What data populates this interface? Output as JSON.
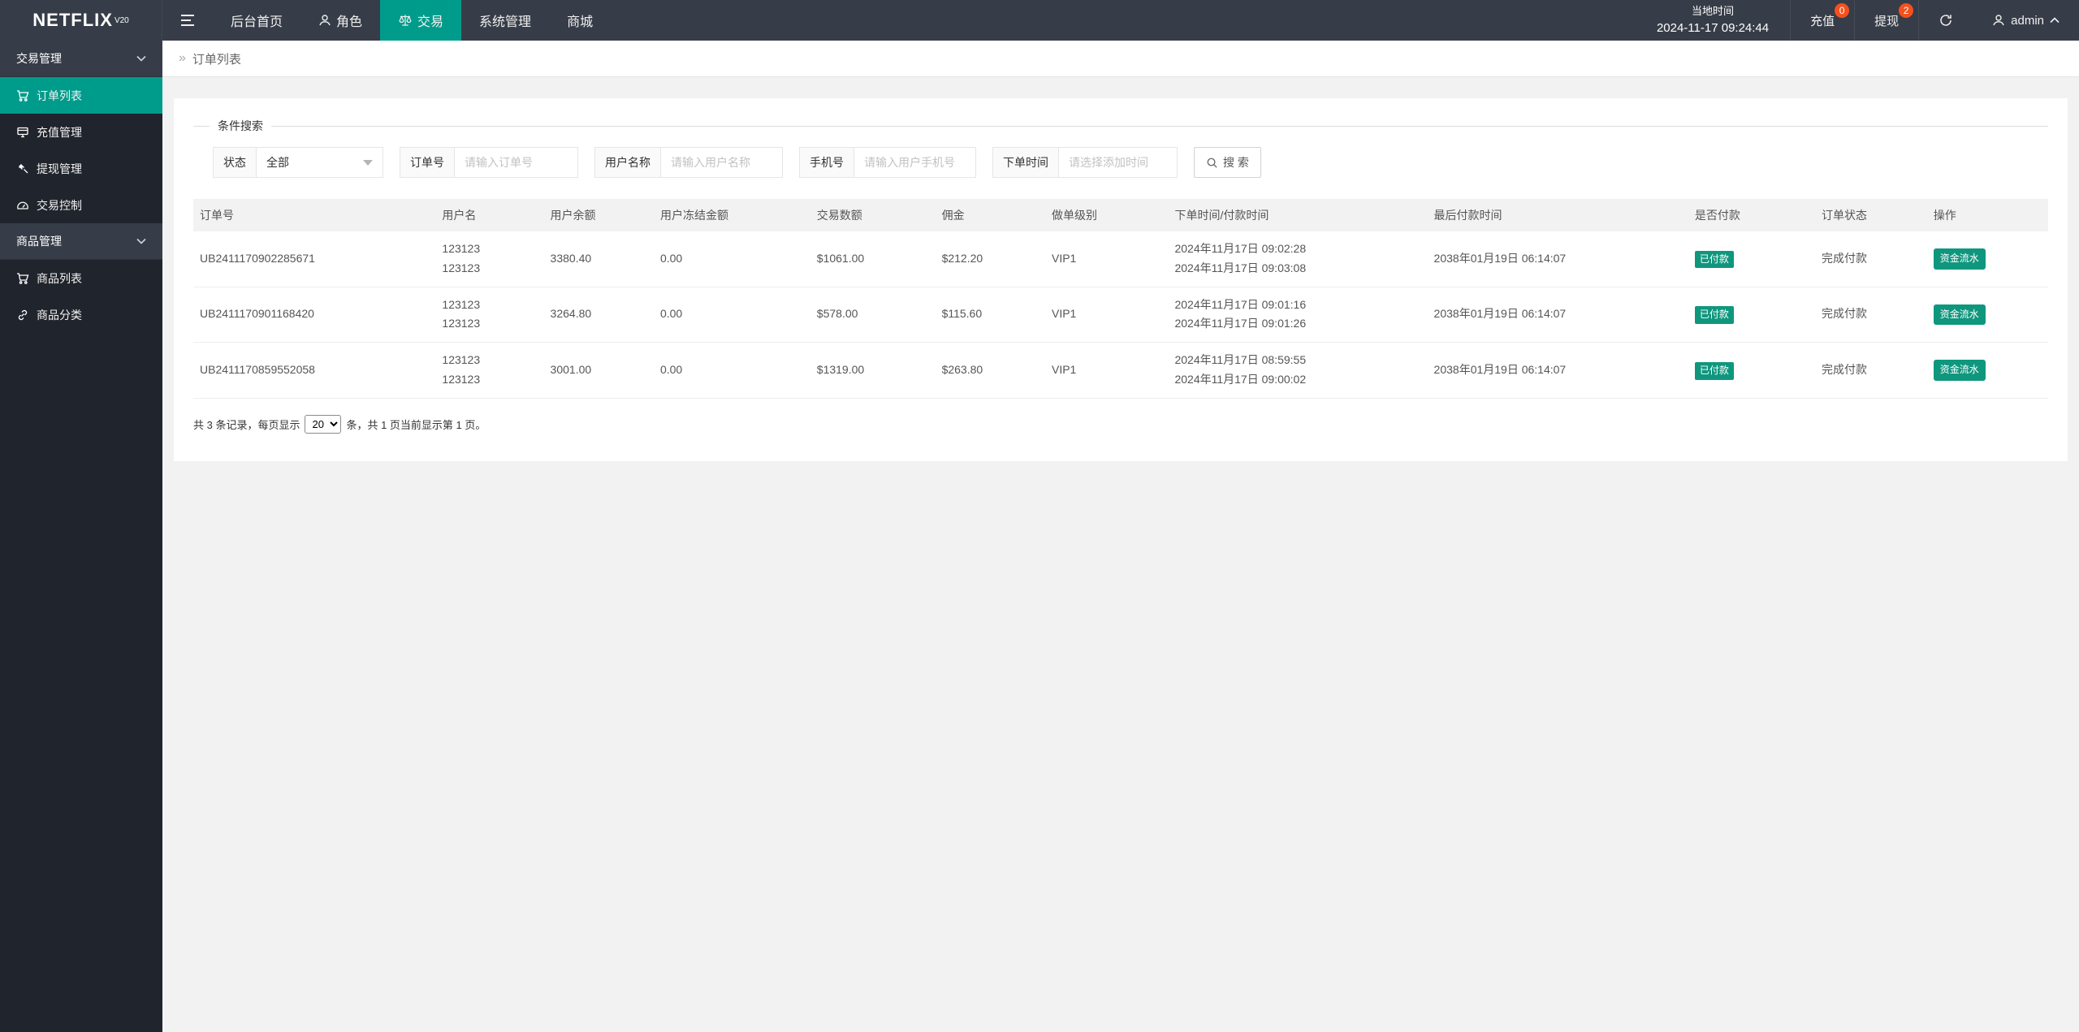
{
  "colors": {
    "header_bg": "#373d48",
    "sidebar_bg": "#20242c",
    "group_bg": "#373d48",
    "accent": "#009c8b",
    "badge_teal": "#0f977e",
    "badge_orange": "#f4511e"
  },
  "header": {
    "logo": "NETFLIX",
    "logo_sup": "V20",
    "nav": [
      {
        "label": "后台首页"
      },
      {
        "label": "角色",
        "icon": "user-icon"
      },
      {
        "label": "交易",
        "icon": "scales-icon",
        "active": true
      },
      {
        "label": "系统管理"
      },
      {
        "label": "商城"
      }
    ],
    "local_time_label": "当地时间",
    "local_time": "2024-11-17 09:24:44",
    "recharge": {
      "label": "充值",
      "badge": "0"
    },
    "withdraw": {
      "label": "提现",
      "badge": "2"
    },
    "user": "admin"
  },
  "sidebar": {
    "groups": [
      {
        "label": "交易管理",
        "items": [
          {
            "label": "订单列表",
            "icon": "cart-icon",
            "active": true
          },
          {
            "label": "充值管理",
            "icon": "pos-terminal-icon"
          },
          {
            "label": "提现管理",
            "icon": "gavel-icon"
          },
          {
            "label": "交易控制",
            "icon": "gauge-icon"
          }
        ]
      },
      {
        "label": "商品管理",
        "items": [
          {
            "label": "商品列表",
            "icon": "cart-icon"
          },
          {
            "label": "商品分类",
            "icon": "link-icon"
          }
        ]
      }
    ]
  },
  "breadcrumb": {
    "arrow": "»",
    "label": "订单列表"
  },
  "search": {
    "legend": "条件搜索",
    "status_label": "状态",
    "status_value": "全部",
    "order_label": "订单号",
    "order_placeholder": "请输入订单号",
    "user_label": "用户名称",
    "user_placeholder": "请输入用户名称",
    "phone_label": "手机号",
    "phone_placeholder": "请输入用户手机号",
    "time_label": "下单时间",
    "time_placeholder": "请选择添加时间",
    "button_label": "搜 索"
  },
  "table": {
    "headers": [
      "订单号",
      "用户名",
      "用户余额",
      "用户冻结金额",
      "交易数额",
      "佣金",
      "做单级别",
      "下单时间/付款时间",
      "最后付款时间",
      "是否付款",
      "订单状态",
      "操作"
    ],
    "rows": [
      {
        "order_no": "UB2411170902285671",
        "username": [
          "123123",
          "123123"
        ],
        "balance": "3380.40",
        "frozen": "0.00",
        "amount": "$1061.00",
        "commission": "$212.20",
        "level": "VIP1",
        "times": [
          "2024年11月17日 09:02:28",
          "2024年11月17日 09:03:08"
        ],
        "last_pay": "2038年01月19日 06:14:07",
        "paid": "已付款",
        "status": "完成付款",
        "action": "资金流水"
      },
      {
        "order_no": "UB2411170901168420",
        "username": [
          "123123",
          "123123"
        ],
        "balance": "3264.80",
        "frozen": "0.00",
        "amount": "$578.00",
        "commission": "$115.60",
        "level": "VIP1",
        "times": [
          "2024年11月17日 09:01:16",
          "2024年11月17日 09:01:26"
        ],
        "last_pay": "2038年01月19日 06:14:07",
        "paid": "已付款",
        "status": "完成付款",
        "action": "资金流水"
      },
      {
        "order_no": "UB2411170859552058",
        "username": [
          "123123",
          "123123"
        ],
        "balance": "3001.00",
        "frozen": "0.00",
        "amount": "$1319.00",
        "commission": "$263.80",
        "level": "VIP1",
        "times": [
          "2024年11月17日 08:59:55",
          "2024年11月17日 09:00:02"
        ],
        "last_pay": "2038年01月19日 06:14:07",
        "paid": "已付款",
        "status": "完成付款",
        "action": "资金流水"
      }
    ]
  },
  "pagination": {
    "prefix": "共 3 条记录，每页显示",
    "page_size": "20",
    "suffix": "条，共 1 页当前显示第 1 页。"
  }
}
